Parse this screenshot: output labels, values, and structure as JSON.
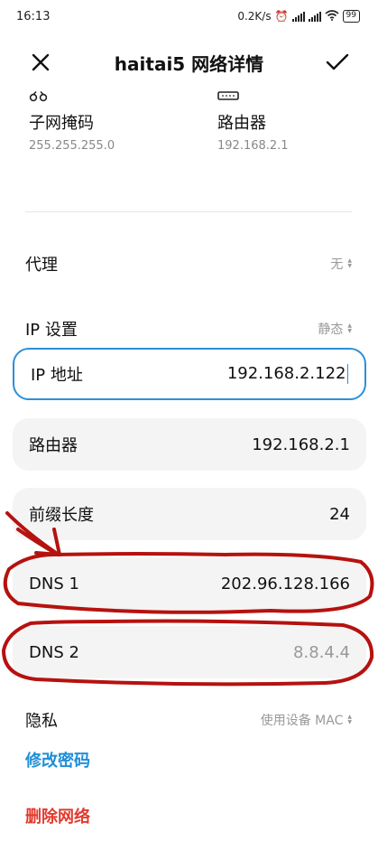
{
  "status": {
    "time": "16:13",
    "net_speed": "0.2K/s",
    "battery": "99"
  },
  "header": {
    "title": "haitai5 网络详情",
    "close_icon": "close-icon",
    "confirm_icon": "check-icon"
  },
  "info": {
    "subnet": {
      "label": "子网掩码",
      "value": "255.255.255.0",
      "icon": "subnet-icon"
    },
    "router": {
      "label": "路由器",
      "value": "192.168.2.1",
      "icon": "router-icon"
    }
  },
  "proxy": {
    "label": "代理",
    "value": "无"
  },
  "ip_settings": {
    "label": "IP 设置",
    "value": "静态"
  },
  "fields": {
    "ip_address": {
      "label": "IP 地址",
      "value": "192.168.2.122"
    },
    "gateway": {
      "label": "路由器",
      "value": "192.168.2.1"
    },
    "prefix": {
      "label": "前缀长度",
      "value": "24"
    },
    "dns1": {
      "label": "DNS 1",
      "value": "202.96.128.166"
    },
    "dns2": {
      "label": "DNS 2",
      "value": "8.8.4.4"
    }
  },
  "privacy": {
    "label": "隐私",
    "value": "使用设备 MAC"
  },
  "actions": {
    "change_password": "修改密码",
    "delete_network": "删除网络"
  },
  "colors": {
    "accent_blue": "#1e8fd8",
    "danger_red": "#e23a2e",
    "annotation_red": "#b5120f"
  }
}
